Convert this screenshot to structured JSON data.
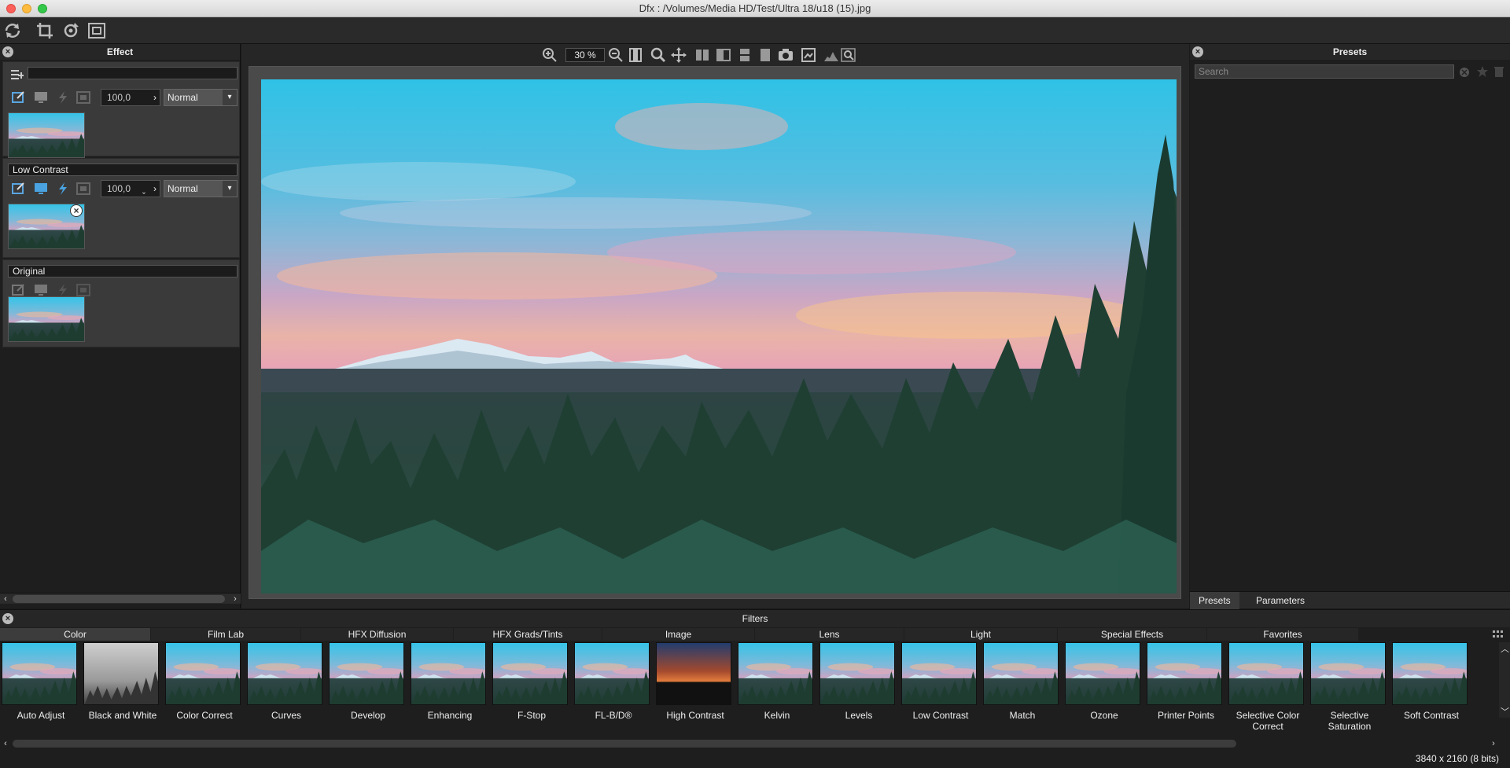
{
  "window": {
    "title": "Dfx : /Volumes/Media HD/Test/Ultra 18/u18 (15).jpg"
  },
  "toolbar": {
    "icons": [
      "refresh-icon",
      "crop-icon",
      "rotate-icon",
      "fit-frame-icon"
    ]
  },
  "effect_panel": {
    "title": "Effect",
    "layers": [
      {
        "name": "",
        "opacity": "100,0",
        "blend": "Normal",
        "has_remove": false
      },
      {
        "name": "Low Contrast",
        "opacity": "100,0",
        "blend": "Normal",
        "has_remove": true
      },
      {
        "name": "Original",
        "opacity": "",
        "blend": "",
        "has_remove": false
      }
    ]
  },
  "viewer": {
    "zoom": "30 %"
  },
  "presets_panel": {
    "title": "Presets",
    "search_placeholder": "Search",
    "tabs": [
      "Presets",
      "Parameters"
    ],
    "active_tab": "Presets"
  },
  "filters": {
    "title": "Filters",
    "categories": [
      "Color",
      "Film Lab",
      "HFX Diffusion",
      "HFX Grads/Tints",
      "Image",
      "Lens",
      "Light",
      "Special Effects",
      "Favorites"
    ],
    "active_category": "Color",
    "items": [
      {
        "label": "Auto Adjust"
      },
      {
        "label": "Black and White"
      },
      {
        "label": "Color Correct"
      },
      {
        "label": "Curves"
      },
      {
        "label": "Develop"
      },
      {
        "label": "Enhancing"
      },
      {
        "label": "F-Stop"
      },
      {
        "label": "FL-B/D®"
      },
      {
        "label": "High Contrast"
      },
      {
        "label": "Kelvin"
      },
      {
        "label": "Levels"
      },
      {
        "label": "Low Contrast"
      },
      {
        "label": "Match"
      },
      {
        "label": "Ozone"
      },
      {
        "label": "Printer Points"
      },
      {
        "label": "Selective Color Correct"
      },
      {
        "label": "Selective Saturation"
      },
      {
        "label": "Soft Contrast"
      }
    ]
  },
  "status": {
    "dimensions": "3840 x 2160 (8 bits)"
  },
  "colors": {
    "accent": "#4aa3e0",
    "panel": "#1e1e1e",
    "toolbar": "#2a2a2a"
  }
}
